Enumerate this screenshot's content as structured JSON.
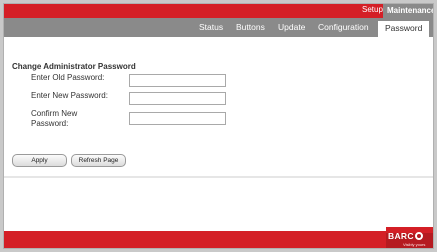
{
  "header": {
    "setup_label": "Setup",
    "maintenance_label": "Maintenance"
  },
  "tabs": [
    {
      "label": "Status"
    },
    {
      "label": "Buttons"
    },
    {
      "label": "Update"
    },
    {
      "label": "Configuration"
    },
    {
      "label": "Password",
      "active": true
    }
  ],
  "form": {
    "title": "Change Administrator Password",
    "old_password_label": "Enter Old Password:",
    "new_password_label": "Enter New Password:",
    "confirm_label_line1": "Confirm New",
    "confirm_label_line2": "Password:",
    "old_password_value": "",
    "new_password_value": "",
    "confirm_value": ""
  },
  "buttons": {
    "apply": "Apply",
    "refresh": "Refresh Page"
  },
  "logo": {
    "text": "BARC",
    "tagline": "Visibly yours"
  },
  "colors": {
    "brand_red": "#d41f26",
    "tab_bar_grey": "#8a8a8a"
  }
}
